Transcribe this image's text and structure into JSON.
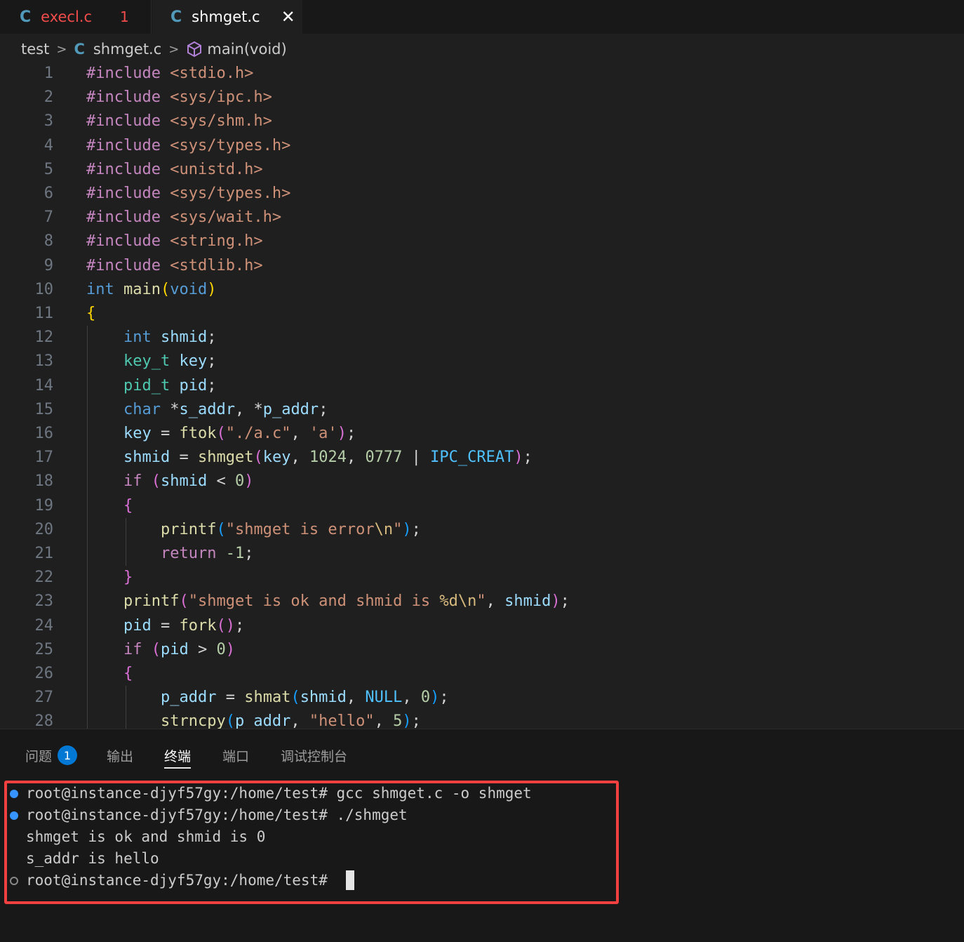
{
  "tabs": [
    {
      "icon": "c-file-icon",
      "icon_text": "C",
      "label": "execl.c",
      "problems": "1"
    },
    {
      "icon": "c-file-icon",
      "icon_text": "C",
      "label": "shmget.c",
      "close": "✕"
    }
  ],
  "breadcrumb": {
    "folder": "test",
    "file_icon_text": "C",
    "file": "shmget.c",
    "symbol": "main(void)"
  },
  "editor": {
    "line_numbers": [
      "1",
      "2",
      "3",
      "4",
      "5",
      "6",
      "7",
      "8",
      "9",
      "10",
      "11",
      "12",
      "13",
      "14",
      "15",
      "16",
      "17",
      "18",
      "19",
      "20",
      "21",
      "22",
      "23",
      "24",
      "25",
      "26",
      "27",
      "28"
    ],
    "lines": [
      "#include <stdio.h>",
      "#include <sys/ipc.h>",
      "#include <sys/shm.h>",
      "#include <sys/types.h>",
      "#include <unistd.h>",
      "#include <sys/types.h>",
      "#include <sys/wait.h>",
      "#include <string.h>",
      "#include <stdlib.h>",
      "int main(void)",
      "{",
      "    int shmid;",
      "    key_t key;",
      "    pid_t pid;",
      "    char *s_addr, *p_addr;",
      "    key = ftok(\"./a.c\", 'a');",
      "    shmid = shmget(key, 1024, 0777 | IPC_CREAT);",
      "    if (shmid < 0)",
      "    {",
      "        printf(\"shmget is error\\n\");",
      "        return -1;",
      "    }",
      "    printf(\"shmget is ok and shmid is %d\\n\", shmid);",
      "    pid = fork();",
      "    if (pid > 0)",
      "    {",
      "        p_addr = shmat(shmid, NULL, 0);",
      "        strncpy(p_addr, \"hello\", 5);"
    ]
  },
  "panel": {
    "tabs": [
      "问题",
      "输出",
      "终端",
      "端口",
      "调试控制台"
    ],
    "active_tab": "终端",
    "problems_badge": "1"
  },
  "terminal": {
    "lines": [
      "root@instance-djyf57gy:/home/test# gcc shmget.c -o shmget",
      "root@instance-djyf57gy:/home/test# ./shmget",
      "shmget is ok and shmid is 0",
      "s_addr is hello",
      "root@instance-djyf57gy:/home/test# "
    ]
  },
  "colors": {
    "accent": "#0078d4",
    "highlight_border": "#f04040",
    "error": "#f14c4c"
  }
}
